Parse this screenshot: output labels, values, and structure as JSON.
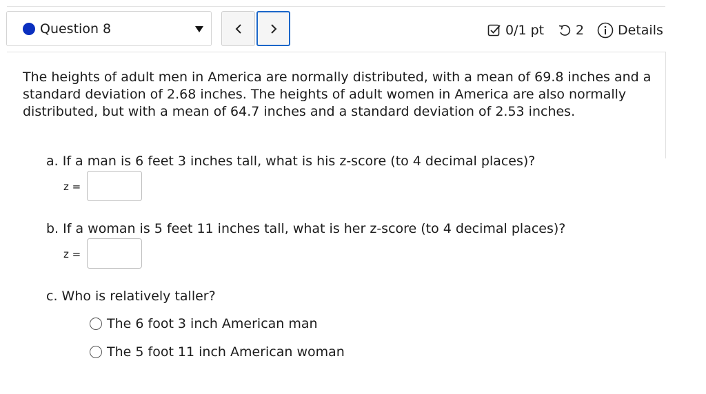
{
  "header": {
    "question_label": "Question 8",
    "score": "0/1 pt",
    "attempts": "2",
    "details_label": "Details"
  },
  "icons": {
    "question_status": "filled-circle-icon",
    "dropdown": "caret-down-icon",
    "prev": "chevron-left-icon",
    "next": "chevron-right-icon",
    "score": "checkbox-icon",
    "attempts": "retry-icon",
    "details": "info-icon"
  },
  "colors": {
    "status_dot": "#0a2fbf",
    "focus_border": "#1a66c9"
  },
  "problem": {
    "intro": "The heights of adult men in America are normally distributed, with a mean of 69.8 inches and a standard deviation of 2.68 inches. The heights of adult women in America are also normally distributed, but with a mean of 64.7 inches and a standard deviation of 2.53 inches.",
    "part_a": {
      "question": "a. If a man is 6 feet 3 inches tall, what is his z-score (to 4 decimal places)?",
      "z_label": "z =",
      "value": ""
    },
    "part_b": {
      "question": "b. If a woman is 5 feet 11 inches tall, what is her z-score (to 4 decimal places)?",
      "z_label": "z =",
      "value": ""
    },
    "part_c": {
      "question": "c. Who is relatively taller?",
      "options": [
        "The 6 foot 3 inch American man",
        "The 5 foot 11 inch American woman"
      ]
    }
  }
}
